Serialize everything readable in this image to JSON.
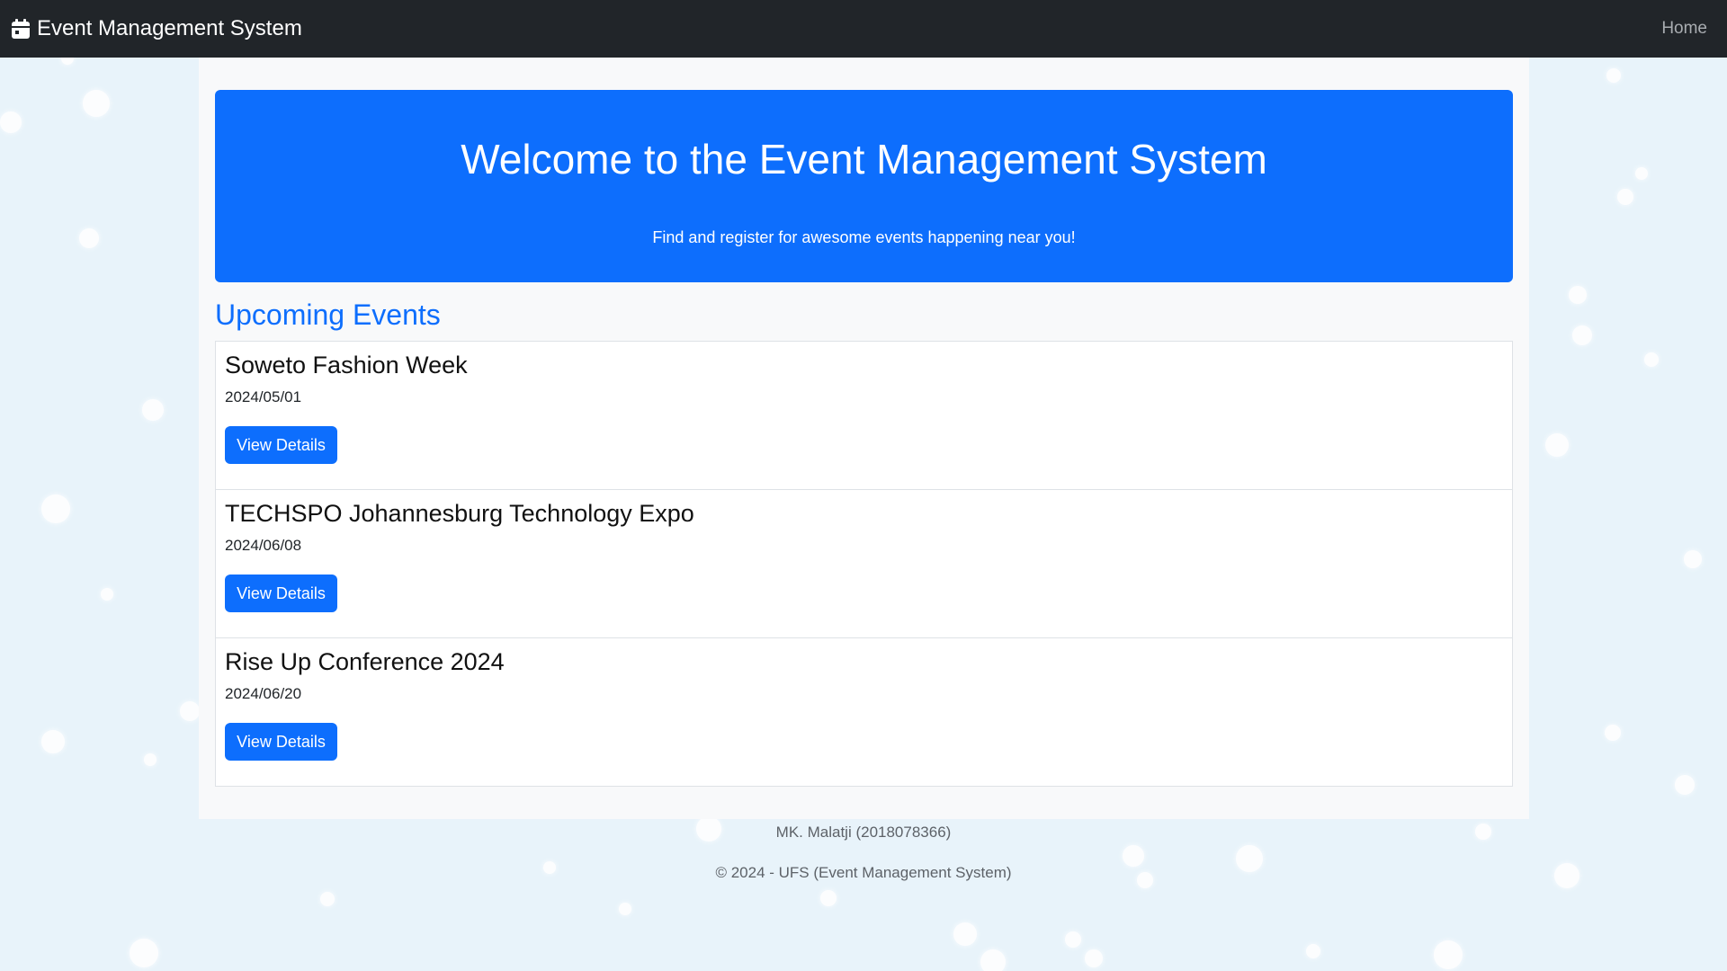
{
  "nav": {
    "brand": "Event Management System",
    "brand_icon": "calendar-icon",
    "home": "Home"
  },
  "hero": {
    "title": "Welcome to the Event Management System",
    "subtitle": "Find and register for awesome events happening near you!"
  },
  "events": {
    "heading": "Upcoming Events",
    "items": [
      {
        "title": "Soweto Fashion Week",
        "date": "2024/05/01",
        "button": "View Details"
      },
      {
        "title": "TECHSPO Johannesburg Technology Expo",
        "date": "2024/06/08",
        "button": "View Details"
      },
      {
        "title": "Rise Up Conference 2024",
        "date": "2024/06/20",
        "button": "View Details"
      }
    ]
  },
  "footer": {
    "author": "MK. Malatji (2018078366)",
    "copyright": "© 2024 - UFS (Event Management System)"
  },
  "colors": {
    "navbar": "#212529",
    "primary": "#0d6efd",
    "background": "#e8f3fa"
  }
}
